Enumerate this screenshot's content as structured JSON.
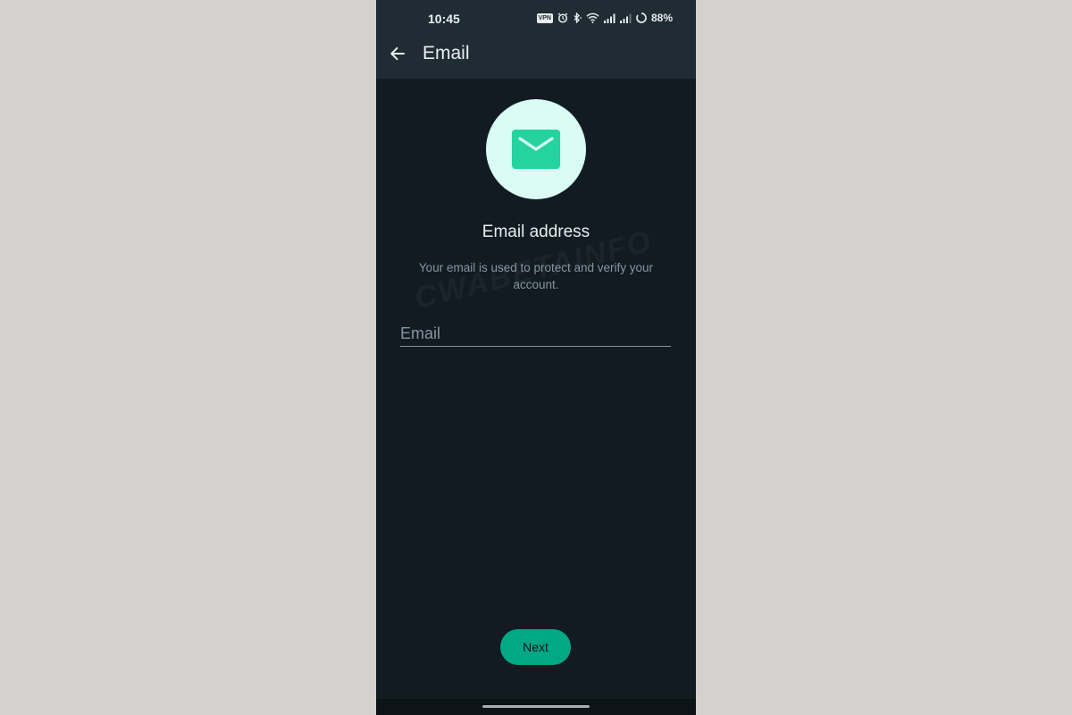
{
  "status_bar": {
    "time": "10:45",
    "vpn_label": "VPN",
    "battery": "88%",
    "icons": [
      "vpn-icon",
      "alarm-icon",
      "bluetooth-icon",
      "wifi-icon",
      "signal-icon",
      "signal-icon-2",
      "battery-saver-icon"
    ]
  },
  "header": {
    "title": "Email",
    "back_icon": "arrow-left-icon"
  },
  "main": {
    "icon": "envelope-icon",
    "title": "Email address",
    "description": "Your email is used to protect and verify your account.",
    "email_value": "",
    "email_placeholder": "Email",
    "next_label": "Next",
    "watermark": "CWABETAINFO"
  },
  "colors": {
    "background": "#111b21",
    "header": "#1f2c34",
    "accent": "#00a884",
    "icon_circle": "#d9fdf3",
    "icon_green": "#25d3a1",
    "text_primary": "#e9edef",
    "text_secondary": "#8696a0"
  }
}
